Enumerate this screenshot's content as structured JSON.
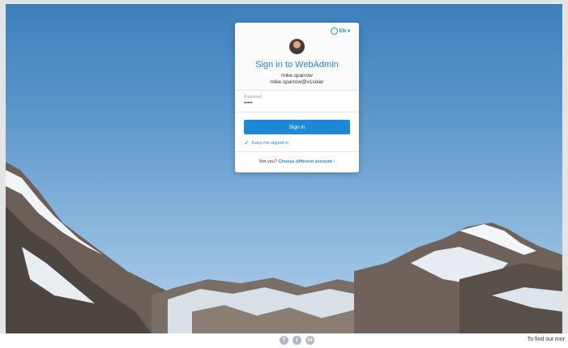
{
  "login": {
    "language": "EN",
    "title": "Sign in to WebAdmin",
    "username": "mike.sparrow",
    "email": "mike.sparrow@x1solar",
    "password_label": "Password",
    "password_value": "•••••",
    "signin_label": "Sign in",
    "keep_signed_in": "Keep me signed in",
    "not_you": "Not you?",
    "choose_account": "Choose different account ›"
  },
  "footer": {
    "social": [
      "f",
      "t",
      "in"
    ],
    "text": "To find out mor"
  },
  "colors": {
    "accent": "#1e88d4"
  }
}
